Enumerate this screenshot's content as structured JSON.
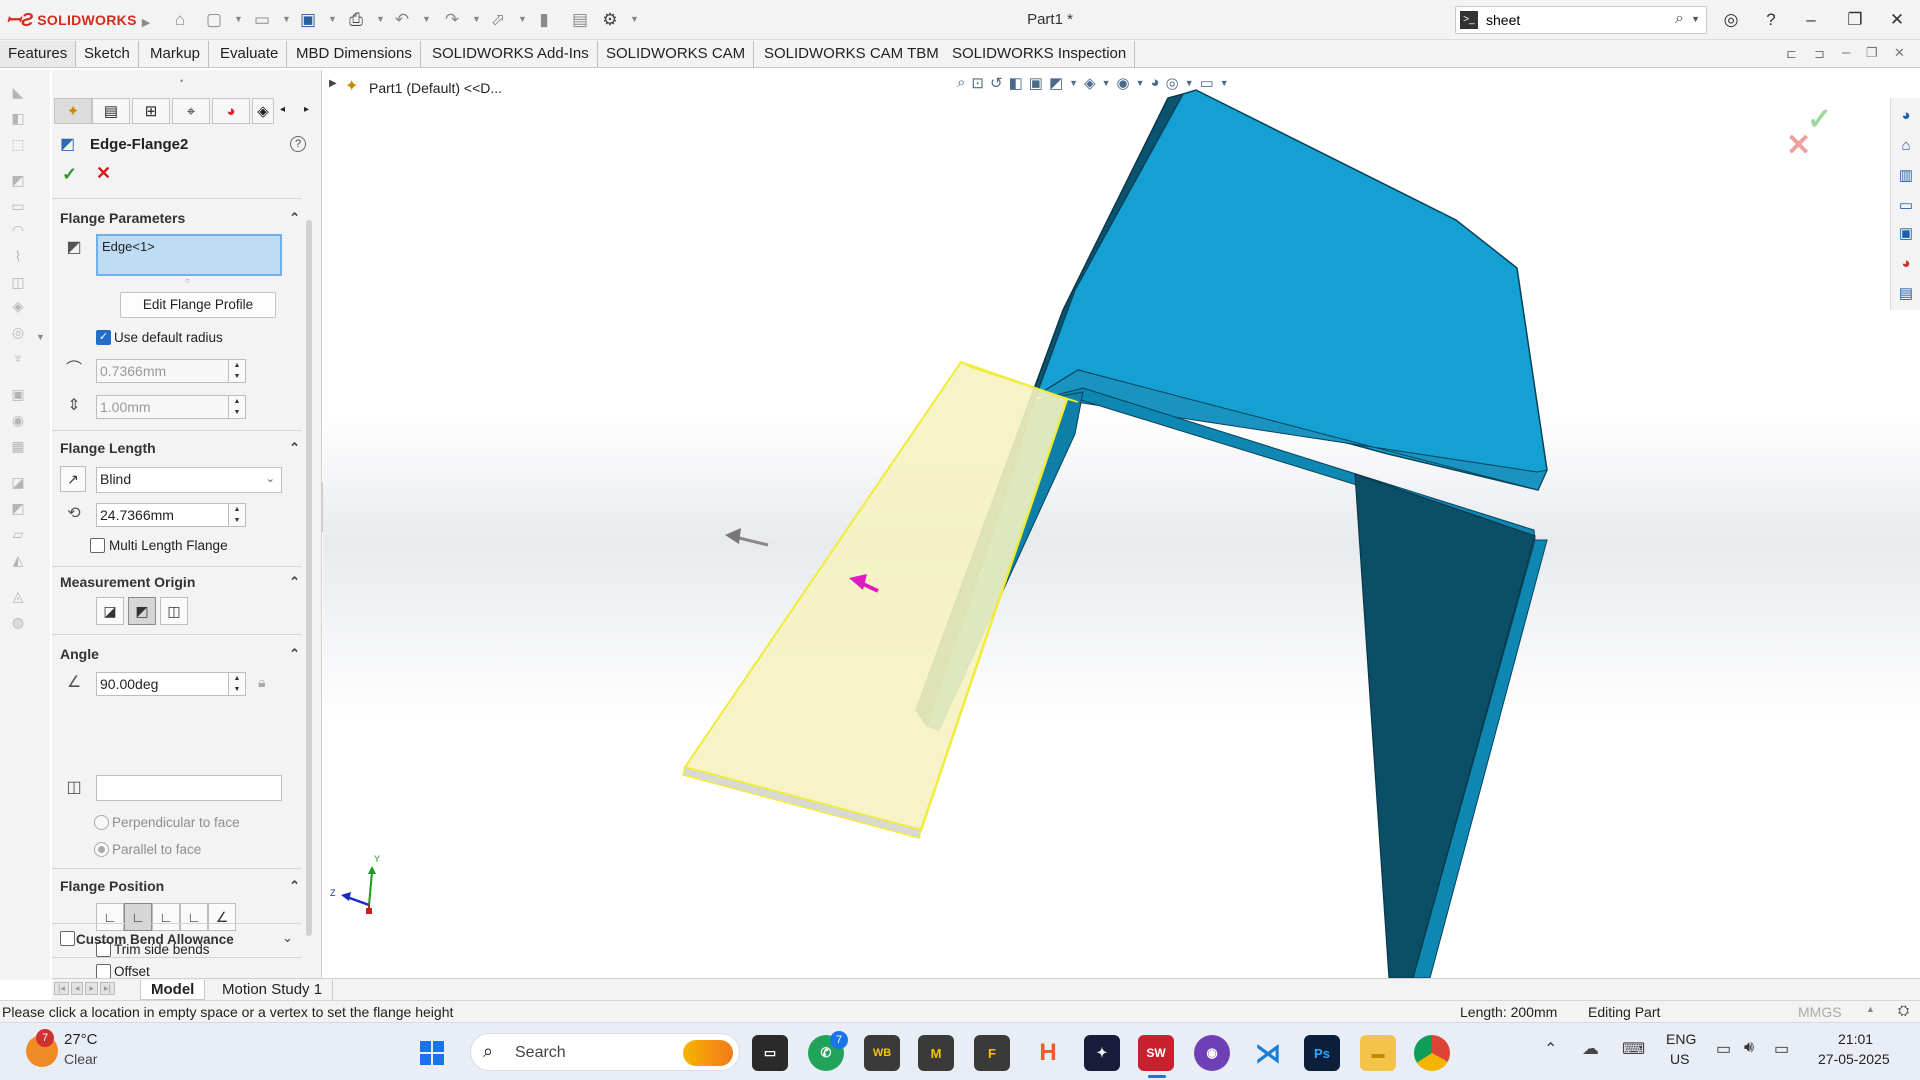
{
  "app": {
    "brand": "SOLIDWORKS",
    "doc_title": "Part1 *"
  },
  "search": {
    "value": "sheet"
  },
  "command_tabs": [
    "Features",
    "Sketch",
    "Markup",
    "Evaluate",
    "MBD Dimensions",
    "SOLIDWORKS Add-Ins",
    "SOLIDWORKS CAM",
    "SOLIDWORKS CAM TBM",
    "SOLIDWORKS Inspection"
  ],
  "feature_tree": {
    "root_label": "Part1 (Default) <<D..."
  },
  "property_manager": {
    "title": "Edge-Flange2",
    "flange_parameters": {
      "header": "Flange Parameters",
      "edge_selection": "Edge<1>",
      "edit_profile_button": "Edit Flange Profile",
      "use_default_radius_label": "Use default radius",
      "use_default_radius_checked": true,
      "radius": "0.7366mm",
      "thickness": "1.00mm"
    },
    "flange_length": {
      "header": "Flange Length",
      "end_condition": "Blind",
      "length": "24.7366mm",
      "multi_length_label": "Multi Length Flange",
      "multi_length_checked": false
    },
    "measurement_origin": {
      "header": "Measurement Origin",
      "selected_index": 1
    },
    "angle": {
      "header": "Angle",
      "value": "90.00deg",
      "face_selection": "",
      "perpendicular_label": "Perpendicular to face",
      "parallel_label": "Parallel to face",
      "selected_option": "parallel"
    },
    "flange_position": {
      "header": "Flange Position",
      "selected_index": 1,
      "trim_side_bends_label": "Trim side bends",
      "trim_side_bends_checked": false,
      "offset_label": "Offset",
      "offset_checked": false
    },
    "custom_bend_allowance": {
      "label": "Custom Bend Allowance",
      "checked": false
    }
  },
  "triad": {
    "y": "Y",
    "z": "Z"
  },
  "bottom_tabs": {
    "model": "Model",
    "motion_study": "Motion Study 1"
  },
  "status_bar": {
    "message": "Please click a location in empty space or a vertex to set the flange height",
    "length": "Length: 200mm",
    "mode": "Editing Part",
    "units": "MMGS"
  },
  "taskbar": {
    "weather_temp": "27°C",
    "weather_desc": "Clear",
    "weather_badge": "7",
    "search_placeholder": "Search",
    "whatsapp_badge": "7",
    "lang_line1": "ENG",
    "lang_line2": "US",
    "time": "21:01",
    "date": "27-05-2025"
  },
  "colors": {
    "part_top": "#14a0d2",
    "part_edge": "#0b6a8a",
    "part_dark": "#0b4f66",
    "preview_fill": "#f5f3c0",
    "preview_outline": "#f0ec3a",
    "accent": "#1f6fc8"
  }
}
